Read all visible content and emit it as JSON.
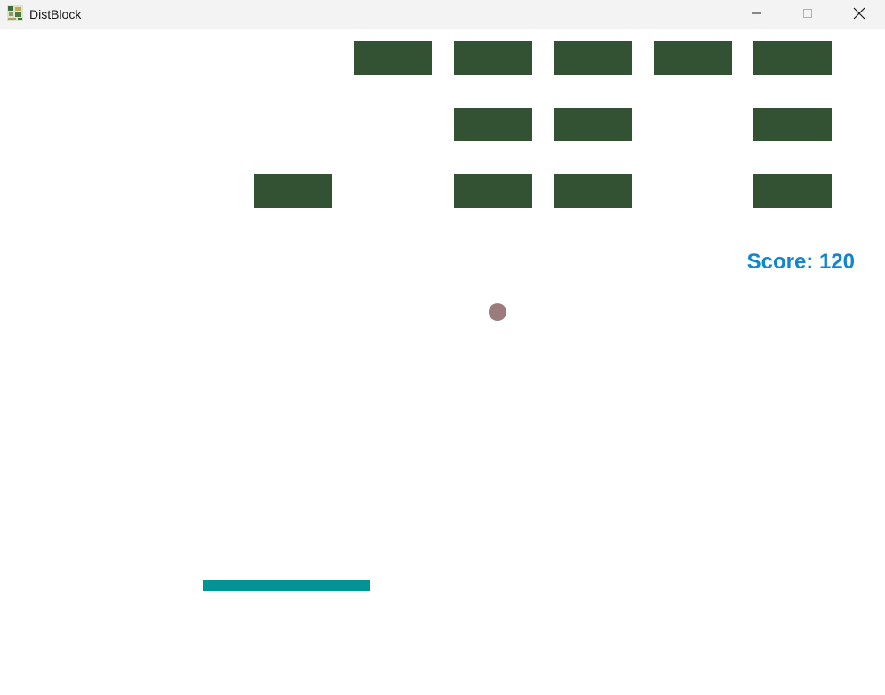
{
  "window": {
    "title": "DistBlock",
    "icon": "distblock-app-icon",
    "controls": {
      "minimize_icon": "minimize-icon",
      "maximize_icon": "maximize-icon",
      "close_icon": "close-icon"
    }
  },
  "game": {
    "score_label": "Score: 120",
    "colors": {
      "background": "#ffffff",
      "brick": "#335233",
      "paddle": "#009494",
      "ball": "#9b7b7b",
      "score": "#0f87cf"
    },
    "bricks": [
      {
        "row": 1,
        "col": 4
      },
      {
        "row": 1,
        "col": 5
      },
      {
        "row": 1,
        "col": 6
      },
      {
        "row": 1,
        "col": 7
      },
      {
        "row": 1,
        "col": 8
      },
      {
        "row": 2,
        "col": 5
      },
      {
        "row": 2,
        "col": 6
      },
      {
        "row": 2,
        "col": 8
      },
      {
        "row": 3,
        "col": 3
      },
      {
        "row": 3,
        "col": 5
      },
      {
        "row": 3,
        "col": 6
      },
      {
        "row": 3,
        "col": 8
      }
    ]
  }
}
